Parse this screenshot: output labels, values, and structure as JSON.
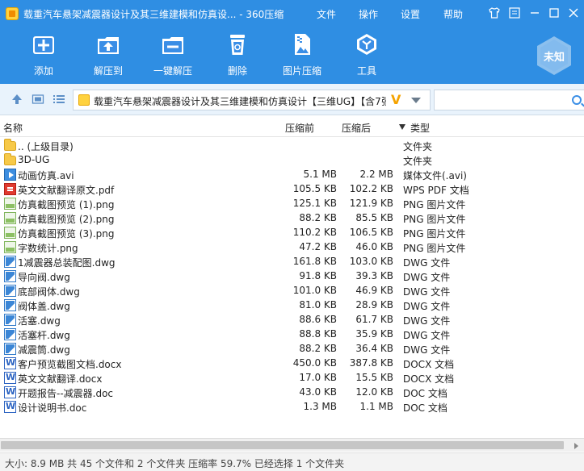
{
  "window": {
    "title": "载重汽车悬架减震器设计及其三维建模和仿真设... - 360压缩",
    "menus": [
      "文件",
      "操作",
      "设置",
      "帮助"
    ]
  },
  "toolbar": {
    "buttons": [
      {
        "label": "添加",
        "icon": "add-icon"
      },
      {
        "label": "解压到",
        "icon": "extract-to-icon"
      },
      {
        "label": "一键解压",
        "icon": "one-click-extract-icon"
      },
      {
        "label": "删除",
        "icon": "delete-icon"
      },
      {
        "label": "图片压缩",
        "icon": "image-compress-icon"
      },
      {
        "label": "工具",
        "icon": "tools-icon"
      }
    ],
    "badge": "未知"
  },
  "address": {
    "path": "载重汽车悬架减震器设计及其三维建模和仿真设计【三维UG】【含7张",
    "vip_mark": "V",
    "search_placeholder": ""
  },
  "columns": {
    "name": "名称",
    "original_size": "压缩前",
    "compressed_size": "压缩后",
    "type": "类型"
  },
  "files": [
    {
      "name": ".. (上级目录)",
      "original": "",
      "compressed": "",
      "type": "文件夹",
      "icon": "folder"
    },
    {
      "name": "3D-UG",
      "original": "",
      "compressed": "",
      "type": "文件夹",
      "icon": "folder"
    },
    {
      "name": "动画仿真.avi",
      "original": "5.1 MB",
      "compressed": "2.2 MB",
      "type": "媒体文件(.avi)",
      "icon": "avi"
    },
    {
      "name": "英文文献翻译原文.pdf",
      "original": "105.5 KB",
      "compressed": "102.2 KB",
      "type": "WPS PDF 文档",
      "icon": "pdf"
    },
    {
      "name": "仿真截图预览 (1).png",
      "original": "125.1 KB",
      "compressed": "121.9 KB",
      "type": "PNG 图片文件",
      "icon": "png"
    },
    {
      "name": "仿真截图预览 (2).png",
      "original": "88.2 KB",
      "compressed": "85.5 KB",
      "type": "PNG 图片文件",
      "icon": "png"
    },
    {
      "name": "仿真截图预览 (3).png",
      "original": "110.2 KB",
      "compressed": "106.5 KB",
      "type": "PNG 图片文件",
      "icon": "png"
    },
    {
      "name": "字数统计.png",
      "original": "47.2 KB",
      "compressed": "46.0 KB",
      "type": "PNG 图片文件",
      "icon": "png"
    },
    {
      "name": "1减震器总装配图.dwg",
      "original": "161.8 KB",
      "compressed": "103.0 KB",
      "type": "DWG 文件",
      "icon": "dwg"
    },
    {
      "name": "导向阀.dwg",
      "original": "91.8 KB",
      "compressed": "39.3 KB",
      "type": "DWG 文件",
      "icon": "dwg"
    },
    {
      "name": "底部阀体.dwg",
      "original": "101.0 KB",
      "compressed": "46.9 KB",
      "type": "DWG 文件",
      "icon": "dwg"
    },
    {
      "name": "阀体盖.dwg",
      "original": "81.0 KB",
      "compressed": "28.9 KB",
      "type": "DWG 文件",
      "icon": "dwg"
    },
    {
      "name": "活塞.dwg",
      "original": "88.6 KB",
      "compressed": "61.7 KB",
      "type": "DWG 文件",
      "icon": "dwg"
    },
    {
      "name": "活塞杆.dwg",
      "original": "88.8 KB",
      "compressed": "35.9 KB",
      "type": "DWG 文件",
      "icon": "dwg"
    },
    {
      "name": "减震筒.dwg",
      "original": "88.2 KB",
      "compressed": "36.4 KB",
      "type": "DWG 文件",
      "icon": "dwg"
    },
    {
      "name": "客户预览截图文档.docx",
      "original": "450.0 KB",
      "compressed": "387.8 KB",
      "type": "DOCX 文档",
      "icon": "doc"
    },
    {
      "name": "英文文献翻译.docx",
      "original": "17.0 KB",
      "compressed": "15.5 KB",
      "type": "DOCX 文档",
      "icon": "doc"
    },
    {
      "name": "开题报告--减震器.doc",
      "original": "43.0 KB",
      "compressed": "12.0 KB",
      "type": "DOC 文档",
      "icon": "doc"
    },
    {
      "name": "设计说明书.doc",
      "original": "1.3 MB",
      "compressed": "1.1 MB",
      "type": "DOC 文档",
      "icon": "doc"
    }
  ],
  "status": {
    "text": "大小: 8.9 MB 共 45 个文件和 2 个文件夹 压缩率 59.7% 已经选择 1 个文件夹"
  },
  "colors": {
    "accent": "#2f8ee3",
    "address_bar_bg": "#e9f3fc"
  }
}
